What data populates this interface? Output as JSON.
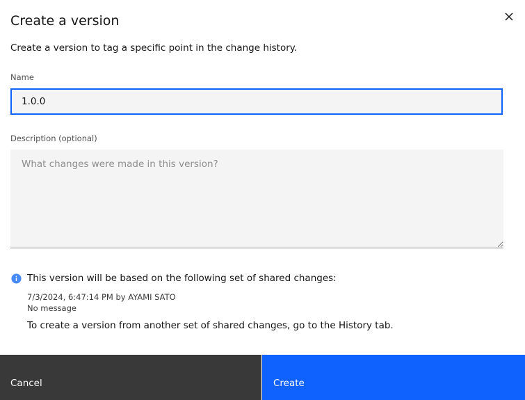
{
  "dialog": {
    "title": "Create a version",
    "subtitle": "Create a version to tag a specific point in the change history."
  },
  "name_field": {
    "label": "Name",
    "value": "1.0.0"
  },
  "description_field": {
    "label": "Description (optional)",
    "placeholder": "What changes were made in this version?",
    "value": ""
  },
  "info": {
    "text": "This version will be based on the following set of shared changes:",
    "changeset_timestamp": "7/3/2024, 6:47:14 PM by AYAMI SATO",
    "changeset_message": "No message",
    "hint": "To create a version from another set of shared changes, go to the History tab."
  },
  "actions": {
    "cancel": "Cancel",
    "create": "Create"
  },
  "icons": {
    "close": "close-icon",
    "info": "info-icon"
  },
  "colors": {
    "primary": "#0f62fe",
    "secondary_button": "#393939",
    "field_background": "#f4f4f4",
    "info_icon": "#4589ff"
  }
}
